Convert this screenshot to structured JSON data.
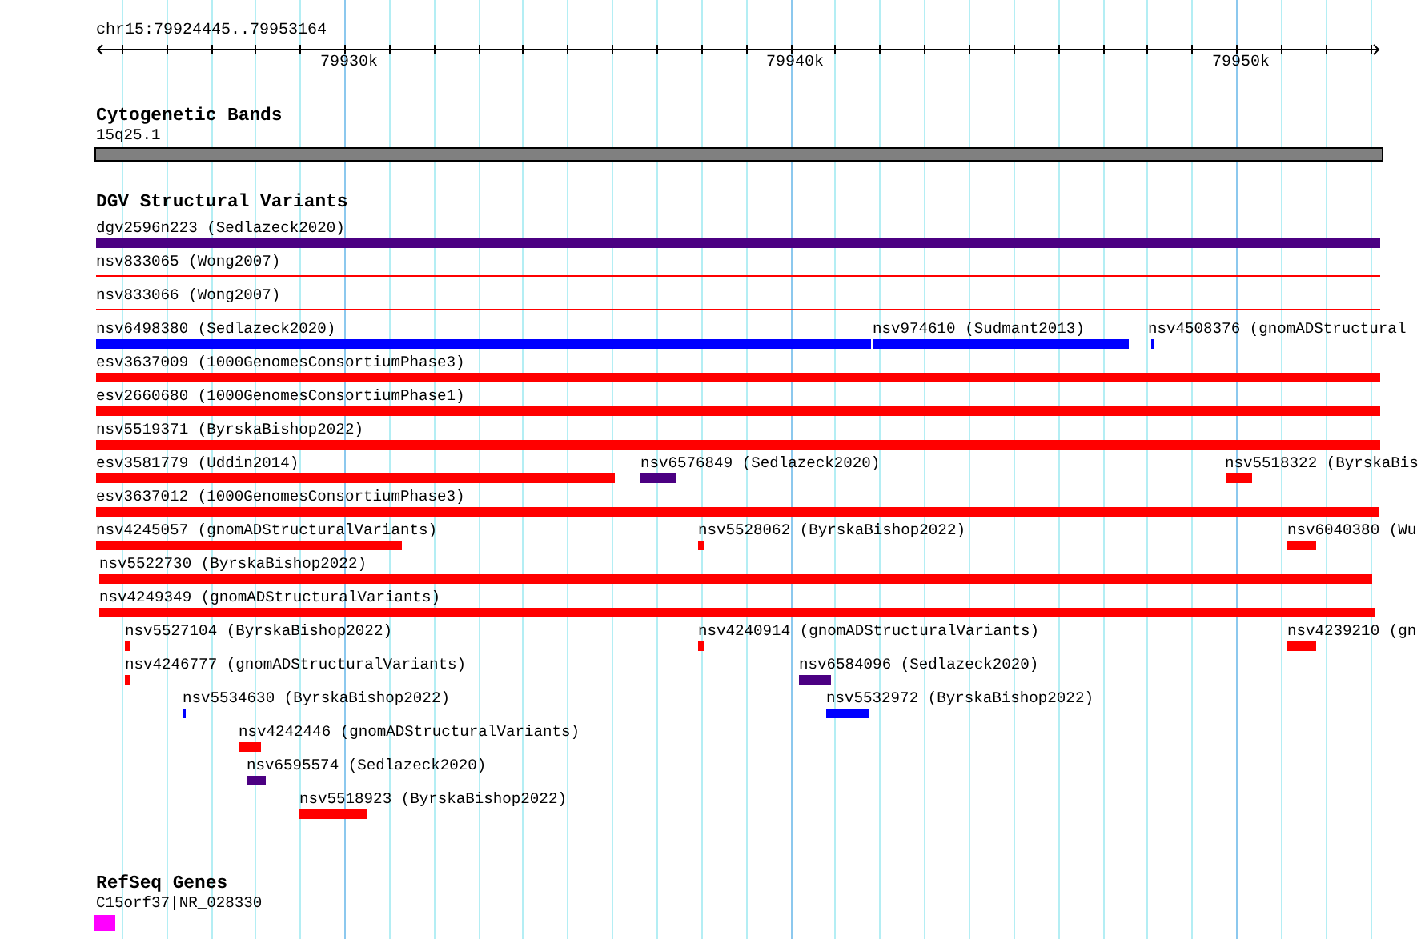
{
  "ruler": {
    "position": "chr15:79924445..79953164",
    "ticks": [
      {
        "label": "79930k"
      },
      {
        "label": "79940k"
      },
      {
        "label": "79950k"
      }
    ]
  },
  "tracks": [
    {
      "kind": "bands",
      "title": "Cytogenetic Bands",
      "features": [
        {
          "label": "15q25.1",
          "color": "#808080"
        }
      ]
    },
    {
      "kind": "variants",
      "title": "DGV Structural Variants",
      "features": [
        {
          "kind": "bar",
          "label": "dgv2596n223 (Sedlazeck2020)",
          "color": "#4b0082"
        },
        {
          "kind": "line",
          "label": "nsv833065 (Wong2007)",
          "color": "#ff0000"
        },
        {
          "kind": "line",
          "label": "nsv833066 (Wong2007)",
          "color": "#ff0000"
        },
        {
          "kind": "bar",
          "label": "nsv6498380 (Sedlazeck2020)",
          "color": "#0000ff"
        },
        {
          "kind": "bar",
          "label": "nsv974610 (Sudmant2013)",
          "color": "#0000ff"
        },
        {
          "kind": "bar",
          "label": "nsv4508376 (gnomADStructural",
          "color": "#0000ff"
        },
        {
          "kind": "bar",
          "label": "esv3637009 (1000GenomesConsortiumPhase3)",
          "color": "#ff0000"
        },
        {
          "kind": "bar",
          "label": "esv2660680 (1000GenomesConsortiumPhase1)",
          "color": "#ff0000"
        },
        {
          "kind": "bar",
          "label": "nsv5519371 (ByrskaBishop2022)",
          "color": "#ff0000"
        },
        {
          "kind": "bar",
          "label": "esv3581779 (Uddin2014)",
          "color": "#ff0000"
        },
        {
          "kind": "bar",
          "label": "nsv6576849 (Sedlazeck2020)",
          "color": "#4b0082"
        },
        {
          "kind": "bar",
          "label": "nsv5518322 (ByrskaBis",
          "color": "#ff0000"
        },
        {
          "kind": "bar",
          "label": "esv3637012 (1000GenomesConsortiumPhase3)",
          "color": "#ff0000"
        },
        {
          "kind": "bar",
          "label": "nsv4245057 (gnomADStructuralVariants)",
          "color": "#ff0000"
        },
        {
          "kind": "bar",
          "label": "nsv5528062 (ByrskaBishop2022)",
          "color": "#ff0000"
        },
        {
          "kind": "bar",
          "label": "nsv6040380 (Wu",
          "color": "#ff0000"
        },
        {
          "kind": "bar",
          "label": "nsv5522730 (ByrskaBishop2022)",
          "color": "#ff0000"
        },
        {
          "kind": "bar",
          "label": "nsv4249349 (gnomADStructuralVariants)",
          "color": "#ff0000"
        },
        {
          "kind": "bar",
          "label": "nsv5527104 (ByrskaBishop2022)",
          "color": "#ff0000"
        },
        {
          "kind": "bar",
          "label": "nsv4240914 (gnomADStructuralVariants)",
          "color": "#ff0000"
        },
        {
          "kind": "bar",
          "label": "nsv4239210 (gn",
          "color": "#ff0000"
        },
        {
          "kind": "bar",
          "label": "nsv4246777 (gnomADStructuralVariants)",
          "color": "#ff0000"
        },
        {
          "kind": "bar",
          "label": "nsv6584096 (Sedlazeck2020)",
          "color": "#4b0082"
        },
        {
          "kind": "bar",
          "label": "nsv5534630 (ByrskaBishop2022)",
          "color": "#0000ff"
        },
        {
          "kind": "bar",
          "label": "nsv5532972 (ByrskaBishop2022)",
          "color": "#0000ff"
        },
        {
          "kind": "bar",
          "label": "nsv4242446 (gnomADStructuralVariants)",
          "color": "#ff0000"
        },
        {
          "kind": "bar",
          "label": "nsv6595574 (Sedlazeck2020)",
          "color": "#4b0082"
        },
        {
          "kind": "bar",
          "label": "nsv5518923 (ByrskaBishop2022)",
          "color": "#ff0000"
        }
      ]
    },
    {
      "kind": "genes",
      "title": "RefSeq Genes",
      "features": [
        {
          "label": "C15orf37|NR_028330",
          "color": "#ff00ff"
        }
      ]
    }
  ]
}
